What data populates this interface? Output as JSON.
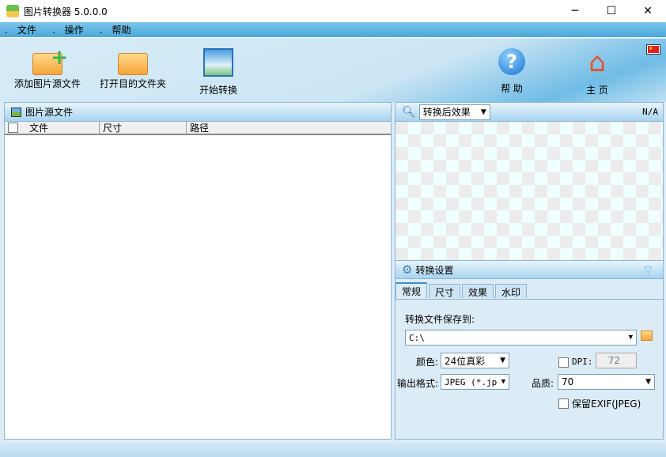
{
  "window": {
    "title": "图片转换器 5.0.0.0",
    "minimize": "─",
    "maximize": "☐",
    "close": "✕"
  },
  "menu": {
    "dot": ".",
    "items": [
      "文件",
      "操作",
      "帮助"
    ]
  },
  "toolbar": {
    "add_source": "添加图片源文件",
    "open_dest": "打开目的文件夹",
    "start": "开始转换",
    "help": "帮 助",
    "home": "主 页",
    "help_glyph": "?",
    "home_glyph": "⌂"
  },
  "source_panel": {
    "title": "图片源文件",
    "columns": [
      "文件",
      "尺寸",
      "路径"
    ]
  },
  "preview_panel": {
    "mode": "转换后效果",
    "info": "N/A"
  },
  "settings": {
    "title": "转换设置",
    "tabs": [
      "常规",
      "尺寸",
      "效果",
      "水印"
    ],
    "save_to_label": "转换文件保存到:",
    "save_to_value": "C:\\",
    "color_label": "颜色:",
    "color_value": "24位真彩",
    "format_label": "输出格式:",
    "format_value": "JPEG (*.jpg",
    "dpi_label": "DPI:",
    "dpi_value": "72",
    "dpi_checked": false,
    "quality_label": "品质:",
    "quality_value": "70",
    "exif_label": "保留EXIF(JPEG)",
    "exif_checked": false
  }
}
